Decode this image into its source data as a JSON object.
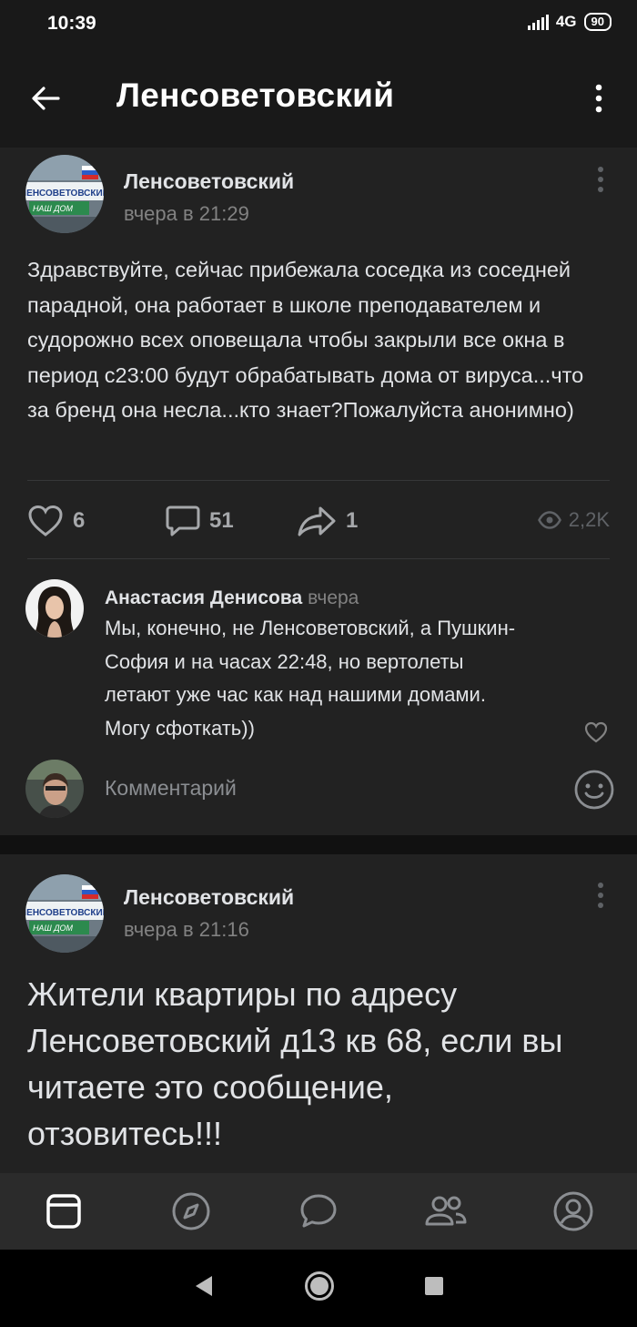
{
  "status_bar": {
    "time": "10:39",
    "network": "4G",
    "battery": "90"
  },
  "header": {
    "title": "Ленсоветовский"
  },
  "posts": [
    {
      "author": "Ленсоветовский",
      "avatar_text_line1": "ЛЕНСОВЕТОВСКИЙ",
      "avatar_text_line2": "НАШ ДОМ",
      "time": "вчера в 21:29",
      "text": "Здравствуйте, сейчас прибежала соседка из соседней парадной, она работает в школе преподавателем и судорожно всех оповещала чтобы закрыли все окна в период с23:00 будут обрабатывать дома от вируса...что за бренд она несла...кто знает?Пожалуйста анонимно)",
      "likes": "6",
      "comments": "51",
      "shares": "1",
      "views": "2,2K",
      "comment": {
        "author": "Анастасия Денисова",
        "time": "вчера",
        "text": "Мы, конечно, не Ленсоветовский, а Пушкин-София и на часах 22:48, но вертолеты летают уже час как над нашими домами. Могу сфоткать))"
      },
      "comment_placeholder": "Комментарий"
    },
    {
      "author": "Ленсоветовский",
      "avatar_text_line1": "ЛЕНСОВЕТОВСКИЙ",
      "avatar_text_line2": "НАШ ДОМ",
      "time": "вчера в 21:16",
      "text": "Жители квартиры по адресу Ленсоветовский д13 кв 68, если вы читаете это сообщение, отзовитесь!!!"
    }
  ],
  "tabs": [
    {
      "icon": "news-icon",
      "active": true
    },
    {
      "icon": "discover-icon",
      "active": false
    },
    {
      "icon": "messages-icon",
      "active": false
    },
    {
      "icon": "friends-icon",
      "active": false
    },
    {
      "icon": "profile-icon",
      "active": false
    }
  ],
  "colors": {
    "background": "#191919",
    "card": "#222222",
    "text": "#e1e3e6",
    "secondary": "#828282"
  }
}
